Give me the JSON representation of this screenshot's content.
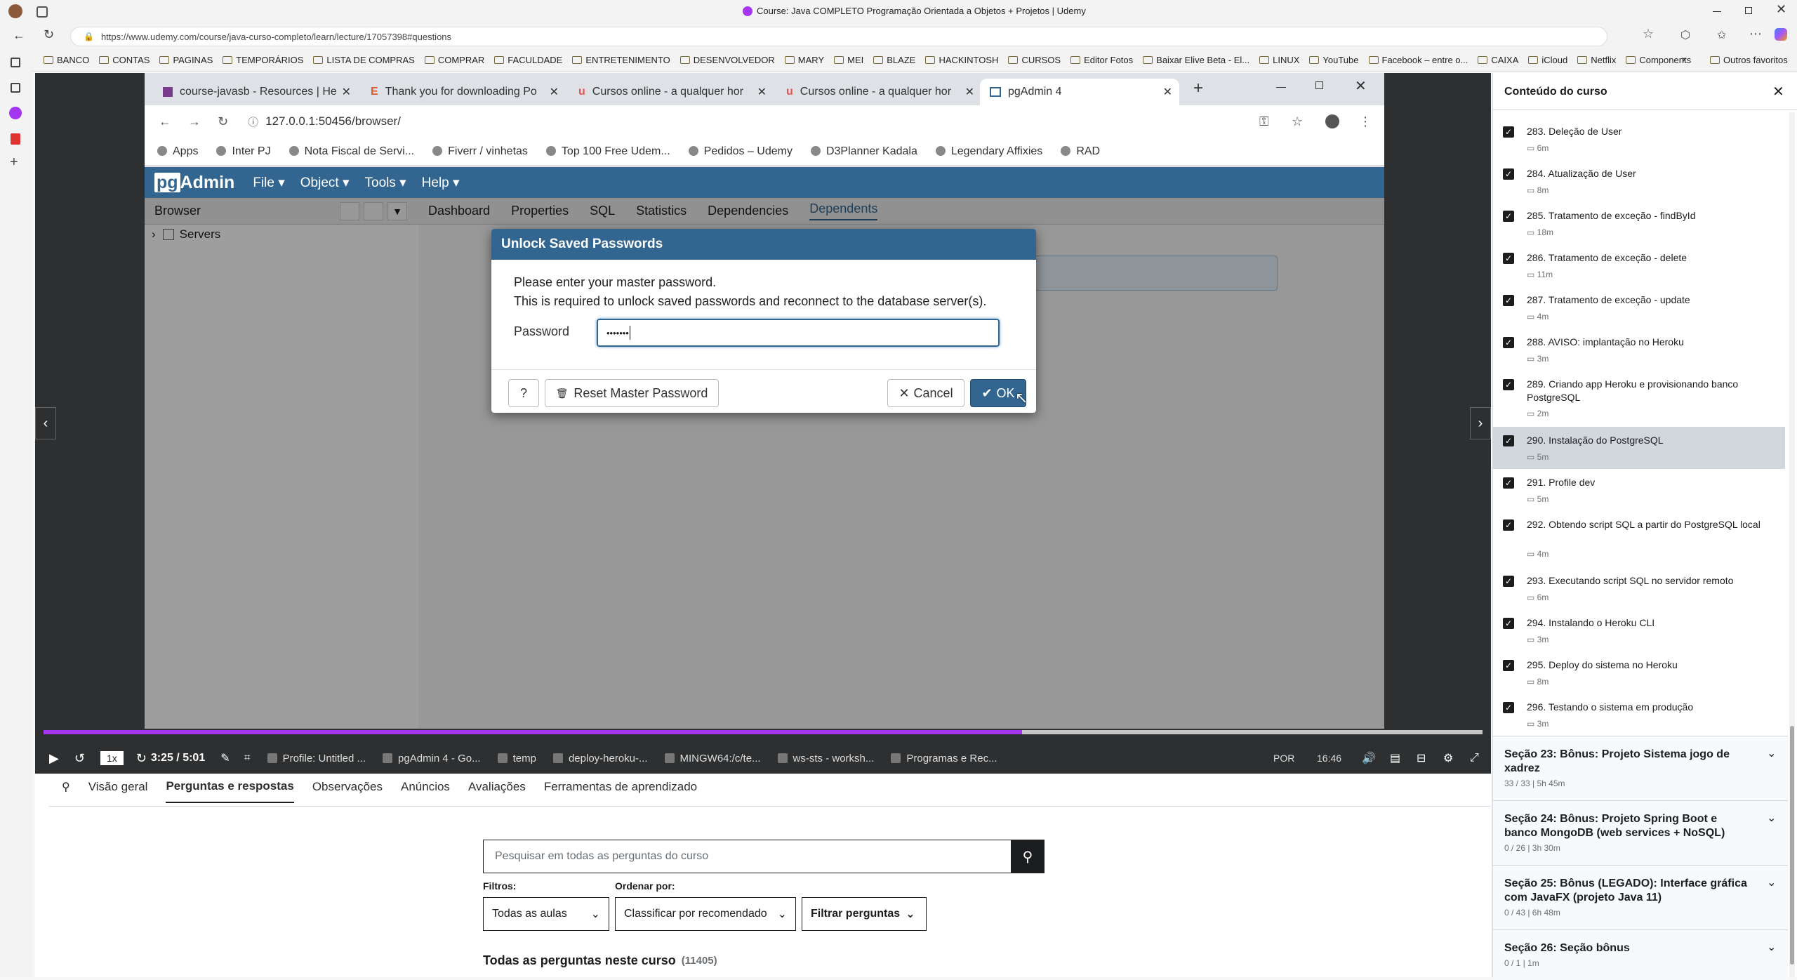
{
  "window": {
    "title": "Course: Java COMPLETO Programação Orientada a Objetos + Projetos | Udemy",
    "url": "https://www.udemy.com/course/java-curso-completo/learn/lecture/17057398#questions"
  },
  "bookmarks": [
    "BANCO",
    "CONTAS",
    "PAGINAS",
    "TEMPORÁRIOS",
    "LISTA DE COMPRAS",
    "COMPRAR",
    "FACULDADE",
    "ENTRETENIMENTO",
    "DESENVOLVEDOR",
    "MARY",
    "MEI",
    "BLAZE",
    "HACKINTOSH",
    "CURSOS",
    "Editor Fotos",
    "Baixar Elive Beta - El...",
    "LINUX",
    "YouTube",
    "Facebook – entre o...",
    "CAIXA",
    "iCloud",
    "Netflix",
    "Components"
  ],
  "bookmarks_other": "Outros favoritos",
  "inner_tabs": [
    "course-javasb - Resources | He",
    "Thank you for downloading Po",
    "Cursos online - a qualquer hor",
    "Cursos online - a qualquer hor",
    "pgAdmin 4"
  ],
  "inner_url": "127.0.0.1:50456/browser/",
  "inner_bookmarks": [
    "Apps",
    "Inter PJ",
    "Nota Fiscal de Servi...",
    "Fiverr / vinhetas",
    "Top 100 Free Udem...",
    "Pedidos – Udemy",
    "D3Planner Kadala",
    "Legendary Affixies",
    "RAD"
  ],
  "pgadmin": {
    "logo_pg": "pg",
    "logo_admin": "Admin",
    "menu": [
      "File",
      "Object",
      "Tools",
      "Help"
    ],
    "browser_label": "Browser",
    "servers": "Servers",
    "tabs": [
      "Dashboard",
      "Properties",
      "SQL",
      "Statistics",
      "Dependencies",
      "Dependents"
    ]
  },
  "dialog": {
    "title": "Unlock Saved Passwords",
    "line1": "Please enter your master password.",
    "line2": "This is required to unlock saved passwords and reconnect to the database server(s).",
    "password_label": "Password",
    "password_value": "•••••••",
    "help": "?",
    "reset": "Reset Master Password",
    "cancel": "Cancel",
    "ok": "OK"
  },
  "player": {
    "speed": "1x",
    "time": "3:25 / 5:01",
    "progress": 0.68,
    "tray_lang": "POR",
    "tray_time": "16:46"
  },
  "taskbar": [
    "Profile: Untitled ...",
    "pgAdmin 4 - Go...",
    "temp",
    "deploy-heroku-...",
    "MINGW64:/c/te...",
    "ws-sts - worksh...",
    "Programas e Rec..."
  ],
  "lower": {
    "tabs": [
      "Visão geral",
      "Perguntas e respostas",
      "Observações",
      "Anúncios",
      "Avaliações",
      "Ferramentas de aprendizado"
    ],
    "search_placeholder": "Pesquisar em todas as perguntas do curso",
    "filters_label": "Filtros:",
    "order_label": "Ordenar por:",
    "filter_all": "Todas as aulas",
    "order_value": "Classificar por recomendado",
    "filter_btn": "Filtrar perguntas",
    "all_questions": "Todas as perguntas neste curso",
    "count": "(11405)"
  },
  "panel": {
    "title": "Conteúdo do curso",
    "lectures": [
      {
        "t": "283. Deleção de User",
        "d": "6m"
      },
      {
        "t": "284. Atualização de User",
        "d": "8m"
      },
      {
        "t": "285. Tratamento de exceção - findById",
        "d": "18m"
      },
      {
        "t": "286. Tratamento de exceção - delete",
        "d": "11m"
      },
      {
        "t": "287. Tratamento de exceção - update",
        "d": "4m"
      },
      {
        "t": "288. AVISO: implantação no Heroku",
        "d": "3m"
      },
      {
        "t": "289. Criando app Heroku e provisionando banco PostgreSQL",
        "d": "2m"
      },
      {
        "t": "290. Instalação do PostgreSQL",
        "d": "5m"
      },
      {
        "t": "291. Profile dev",
        "d": "5m"
      },
      {
        "t": "292. Obtendo script SQL a partir do PostgreSQL local",
        "d": "4m"
      },
      {
        "t": "293. Executando script SQL no servidor remoto",
        "d": "6m"
      },
      {
        "t": "294. Instalando o Heroku CLI",
        "d": "3m"
      },
      {
        "t": "295. Deploy do sistema no Heroku",
        "d": "8m"
      },
      {
        "t": "296. Testando o sistema em produção",
        "d": "3m"
      }
    ],
    "sections": [
      {
        "t": "Seção 23: Bônus: Projeto Sistema jogo de xadrez",
        "s": "33 / 33 | 5h 45m"
      },
      {
        "t": "Seção 24: Bônus: Projeto Spring Boot e banco MongoDB (web services + NoSQL)",
        "s": "0 / 26 | 3h 30m"
      },
      {
        "t": "Seção 25: Bônus (LEGADO): Interface gráfica com JavaFX (projeto Java 11)",
        "s": "0 / 43 | 6h 48m"
      },
      {
        "t": "Seção 26: Seção bônus",
        "s": "0 / 1 | 1m"
      }
    ]
  }
}
